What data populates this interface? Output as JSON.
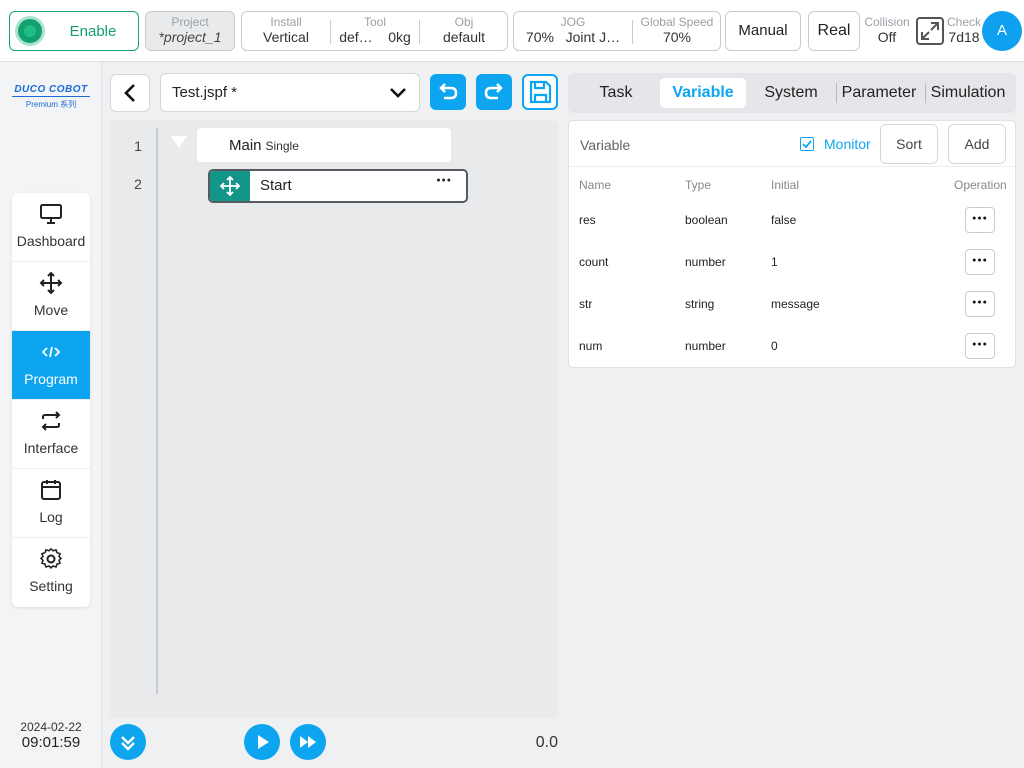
{
  "topbar": {
    "enable_label": "Enable",
    "project": {
      "label": "Project",
      "value": "*project_1"
    },
    "install": {
      "label": "Install",
      "value": "Vertical"
    },
    "tool": {
      "label": "Tool",
      "value": "def…",
      "weight": "0kg"
    },
    "obj": {
      "label": "Obj",
      "value": "default"
    },
    "jog": {
      "label": "JOG",
      "percent": "70%",
      "mode": "Joint J…"
    },
    "global_speed": {
      "label": "Global Speed",
      "value": "70%"
    },
    "mode_button": "Manual",
    "real_button": "Real",
    "collision": {
      "label": "Collision",
      "value": "Off"
    },
    "check": {
      "label": "Check",
      "value": "7d18"
    },
    "avatar_letter": "A"
  },
  "sidebar": {
    "logo": {
      "brand": "DUCO COBOT",
      "sub": "Premium 系列"
    },
    "items": [
      {
        "label": "Dashboard",
        "icon": "monitor-icon"
      },
      {
        "label": "Move",
        "icon": "move-arrows-icon"
      },
      {
        "label": "Program",
        "icon": "code-icon",
        "active": true
      },
      {
        "label": "Interface",
        "icon": "swap-icon"
      },
      {
        "label": "Log",
        "icon": "calendar-icon"
      },
      {
        "label": "Setting",
        "icon": "gear-icon"
      }
    ],
    "date": "2024-02-22",
    "time": "09:01:59"
  },
  "program": {
    "file_name": "Test.jspf *",
    "lines": [
      {
        "num": "1",
        "title": "Main",
        "tag": "Single"
      },
      {
        "num": "2",
        "title": "Start"
      }
    ],
    "speed_value": "0.0"
  },
  "right_panel": {
    "tabs": [
      "Task",
      "Variable",
      "System",
      "Parameter",
      "Simulation"
    ],
    "active_tab": "Variable",
    "variable": {
      "title": "Variable",
      "monitor_label": "Monitor",
      "monitor_checked": true,
      "sort_label": "Sort",
      "add_label": "Add",
      "columns": [
        "Name",
        "Type",
        "Initial",
        "Operation"
      ],
      "rows": [
        {
          "name": "res",
          "type": "boolean",
          "initial": "false"
        },
        {
          "name": "count",
          "type": "number",
          "initial": "1"
        },
        {
          "name": "str",
          "type": "string",
          "initial": "message"
        },
        {
          "name": "num",
          "type": "number",
          "initial": "0"
        }
      ]
    }
  },
  "colors": {
    "accent": "#0ea5f0",
    "enable_green": "#12a070",
    "grip_teal": "#14958a"
  }
}
